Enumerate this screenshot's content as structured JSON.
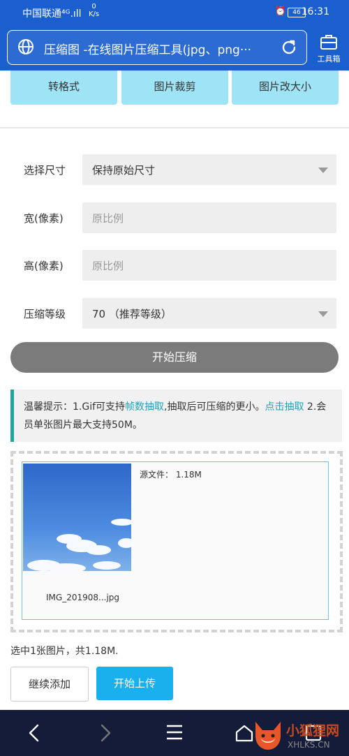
{
  "status_bar": {
    "carrier": "中国联通⁴ᴳ.ıll",
    "net_speed_value": "0",
    "net_speed_unit": "K/s",
    "battery": "46",
    "time": "16:31"
  },
  "browser": {
    "page_title": "压缩图 -在线图片压缩工具(jpg、png···",
    "toolbox_label": "工具箱"
  },
  "quick_actions": [
    "转格式",
    "图片裁剪",
    "图片改大小"
  ],
  "form": {
    "size": {
      "label": "选择尺寸",
      "value": "保持原始尺寸"
    },
    "width": {
      "label": "宽(像素)",
      "placeholder": "原比例"
    },
    "height": {
      "label": "高(像素)",
      "placeholder": "原比例"
    },
    "level": {
      "label": "压缩等级",
      "value": "70 （推荐等级）"
    },
    "start_button": "开始压缩"
  },
  "tip": {
    "prefix": "温馨提示：1.Gif可支持",
    "link1": "帧数抽取",
    "middle": ",抽取后可压缩的更小。",
    "link2": "点击抽取",
    "suffix": " 2.会员单张图片最大支持50M。"
  },
  "upload": {
    "source_size": "源文件：  1.18M",
    "file_name": "IMG_201908...jpg",
    "summary": "选中1张图片，共1.18M.",
    "add_button": "继续添加",
    "upload_button": "开始上传"
  },
  "watermark": {
    "text": "小狐狸网",
    "sub": "XHLKS.CN"
  },
  "colors": {
    "header_blue": "#1b5fcf",
    "quick_button": "#9fe3f7",
    "upload_blue": "#1ab0ee",
    "tip_teal": "#20a79c",
    "nav_bar": "#151c3a"
  },
  "icons": [
    "globe-icon",
    "reload-icon",
    "toolbox-icon",
    "alarm-icon",
    "back-icon",
    "forward-icon",
    "menu-icon",
    "home-icon",
    "tabs-icon",
    "fox-logo-icon"
  ]
}
